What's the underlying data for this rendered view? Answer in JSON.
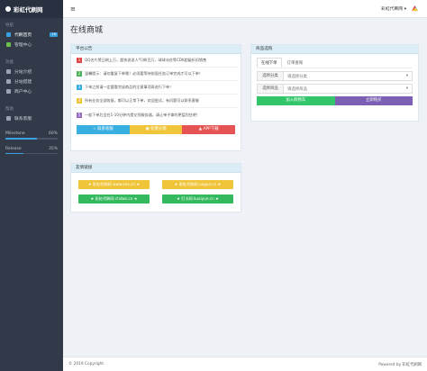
{
  "sidebar": {
    "brand": "彩虹代刷网",
    "sections": [
      {
        "label": "导航",
        "items": [
          {
            "label": "代刷首页",
            "color": "#3c9fe0",
            "badge": "18",
            "active": true
          },
          {
            "label": "管理中心",
            "color": "#6cc04a",
            "badge": "",
            "active": false
          }
        ]
      },
      {
        "label": "功能",
        "items": [
          {
            "label": "分站介绍",
            "color": "#9aa3b1",
            "badge": "",
            "active": false
          },
          {
            "label": "分站搭建",
            "color": "#9aa3b1",
            "badge": "",
            "active": false
          },
          {
            "label": "商户中心",
            "color": "#9aa3b1",
            "badge": "",
            "active": false
          }
        ]
      },
      {
        "label": "帮助",
        "items": [
          {
            "label": "联系客服",
            "color": "#9aa3b1",
            "badge": "",
            "active": false
          }
        ]
      }
    ],
    "progress": [
      {
        "label": "Milestone",
        "value": "60%",
        "fraction": 0.6
      },
      {
        "label": "Release",
        "value": "35%",
        "fraction": 0.35
      }
    ]
  },
  "topbar": {
    "menu_icon": "≡",
    "user": "彩虹代刷网 ▾"
  },
  "page_title": "在线商城",
  "notice": {
    "title": "平台公告",
    "rows": [
      {
        "n": "1",
        "color": "#e04848",
        "text": "QQ名片赞日刷上万，超快说说人气/刷百万，球球冰花等CDK超级折扣销售"
      },
      {
        "n": "2",
        "color": "#4fb35a",
        "text": "温馨提示：请勿重复下单哦！必须要等待前面任务订单完成才可以下单！"
      },
      {
        "n": "3",
        "color": "#39aee0",
        "text": "下单之前请一定要看完该商品的注意事项再进行下单！"
      },
      {
        "n": "4",
        "color": "#f0c53a",
        "text": "所有业务全部恢复，都可以正常下单，欢迎尝试，有问题可以联系客服"
      },
      {
        "n": "5",
        "color": "#9b6cc4",
        "text": "一般下单后会在1-10分钟内提交到服务器，请让单子拿的更猛烈些吧！"
      }
    ],
    "buttons": [
      {
        "label": "☆ 联系客服",
        "color": "#39aee0"
      },
      {
        "label": "▣ 免费分销",
        "color": "#f0c53a"
      },
      {
        "label": "▲ APP下载",
        "color": "#e65353"
      }
    ]
  },
  "friends": {
    "title": "友情链接",
    "links": [
      {
        "label": "★ 彩虹代刷网 www.xxx.cn ★",
        "color": "#f0c53a"
      },
      {
        "label": "★ 彩虹代刷网 uxguo.cn ★",
        "color": "#f0c53a"
      },
      {
        "label": "★ 彩虹代刷网 chdws.cn ★",
        "color": "#34b95f"
      },
      {
        "label": "★ 打卡网 kuaiyun.cn ★",
        "color": "#34b95f"
      }
    ]
  },
  "order": {
    "title": "商品选购",
    "tabs": [
      {
        "label": "在线下单"
      },
      {
        "label": "订单查询"
      }
    ],
    "fields": [
      {
        "label": "选择分类",
        "value": "请选择分类"
      },
      {
        "label": "选择商品",
        "value": "请选择商品"
      }
    ],
    "actions": [
      {
        "label": "加入购物车",
        "color": "#33c56a"
      },
      {
        "label": "立即购买",
        "color": "#7a5fb3"
      }
    ]
  },
  "footer": {
    "left": "© 2019 Copyright.",
    "right": "Powered by 彩虹代刷网"
  }
}
